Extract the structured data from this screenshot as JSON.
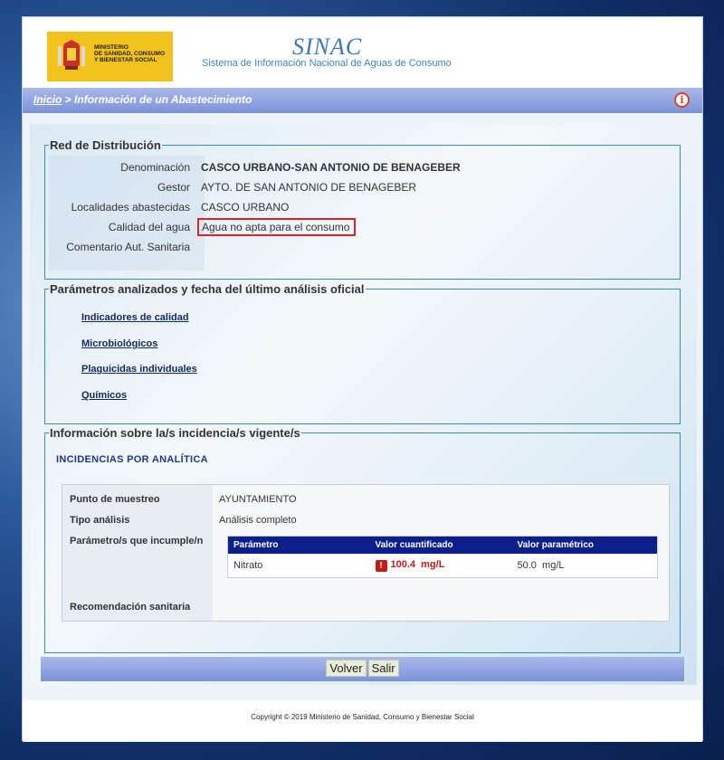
{
  "header": {
    "logo_text": [
      "MINISTERIO",
      "DE SANIDAD, CONSUMO",
      "Y BIENESTAR SOCIAL"
    ],
    "app_title": "SINAC",
    "app_subtitle": "Sistema de Información Nacional de Aguas de Consumo"
  },
  "breadcrumb": {
    "home": "Inicio",
    "separator": " > ",
    "current": "Información de un Abastecimiento",
    "info_icon": "info-icon"
  },
  "red": {
    "legend": "Red de Distribución",
    "fields": [
      {
        "label": "Denominación",
        "value": "CASCO URBANO-SAN ANTONIO DE BENAGEBER"
      },
      {
        "label": "Gestor",
        "value": "AYTO. DE SAN ANTONIO DE BENAGEBER"
      },
      {
        "label": "Localidades abastecidas",
        "value": "CASCO URBANO"
      },
      {
        "label": "Calidad del agua",
        "value": "Agua no apta para el consumo"
      },
      {
        "label": "Comentario Aut. Sanitaria",
        "value": ""
      }
    ]
  },
  "parametros": {
    "legend": "Parámetros analizados y fecha del último análisis oficial",
    "links": [
      "Indicadores de calidad",
      "Microbiológicos",
      "Plaguicidas individuales",
      "Químicos"
    ]
  },
  "incidencias": {
    "legend": "Información sobre la/s incidencia/s vigente/s",
    "subtitle": "INCIDENCIAS POR ANALÍTICA",
    "punto_label": "Punto de muestreo",
    "punto_value": "AYUNTAMIENTO",
    "tipo_label": "Tipo análisis",
    "tipo_value": "Análisis completo",
    "incumple_label": "Parámetro/s que incumple/n",
    "recomendacion_label": "Recomendación sanitaria",
    "table": {
      "headers": [
        "Parámetro",
        "Valor cuantificado",
        "Valor paramétrico"
      ],
      "rows": [
        {
          "parametro": "Nitrato",
          "valor": "100.4",
          "valor_unit": "mg/L",
          "parametrico": "50.0",
          "parametrico_unit": "mg/L",
          "alert": "!"
        }
      ]
    }
  },
  "actions": {
    "back": "Volver",
    "exit": "Salir"
  },
  "footer": {
    "copyright": "Copyright © 2019 Ministerio de Sanidad, Consumo y Bienestar Social"
  },
  "colors": {
    "accent": "#0c1f8a",
    "alert": "#c41a1a",
    "highlight_border": "#d8232a"
  }
}
